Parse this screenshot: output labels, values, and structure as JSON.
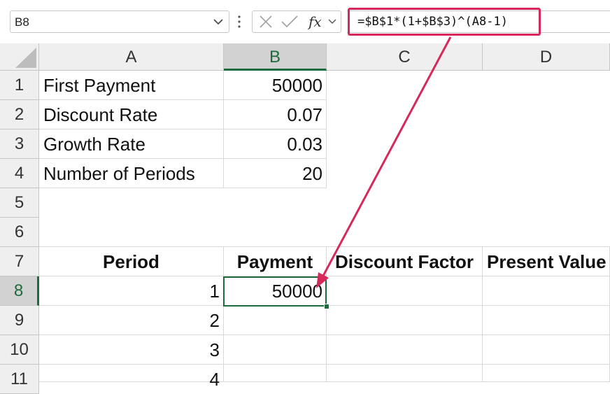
{
  "formula_bar": {
    "name_box": "B8",
    "fx_label": "fx",
    "formula": "=$B$1*(1+$B$3)^(A8-1)"
  },
  "columns": [
    "A",
    "B",
    "C",
    "D"
  ],
  "rows": [
    "1",
    "2",
    "3",
    "4",
    "5",
    "6",
    "7",
    "8",
    "9",
    "10",
    "11"
  ],
  "cells": {
    "A1": "First Payment",
    "B1": "50000",
    "A2": "Discount Rate",
    "B2": "0.07",
    "A3": "Growth Rate",
    "B3": "0.03",
    "A4": "Number of Periods",
    "B4": "20",
    "A7": "Period",
    "B7": "Payment",
    "C7": "Discount Factor",
    "D7": "Present Value",
    "A8": "1",
    "B8": "50000",
    "A9": "2",
    "A10": "3",
    "A11": "4"
  },
  "selected_cell": "B8",
  "colors": {
    "accent_green": "#1d6b3c",
    "highlight": "#d6285a"
  }
}
